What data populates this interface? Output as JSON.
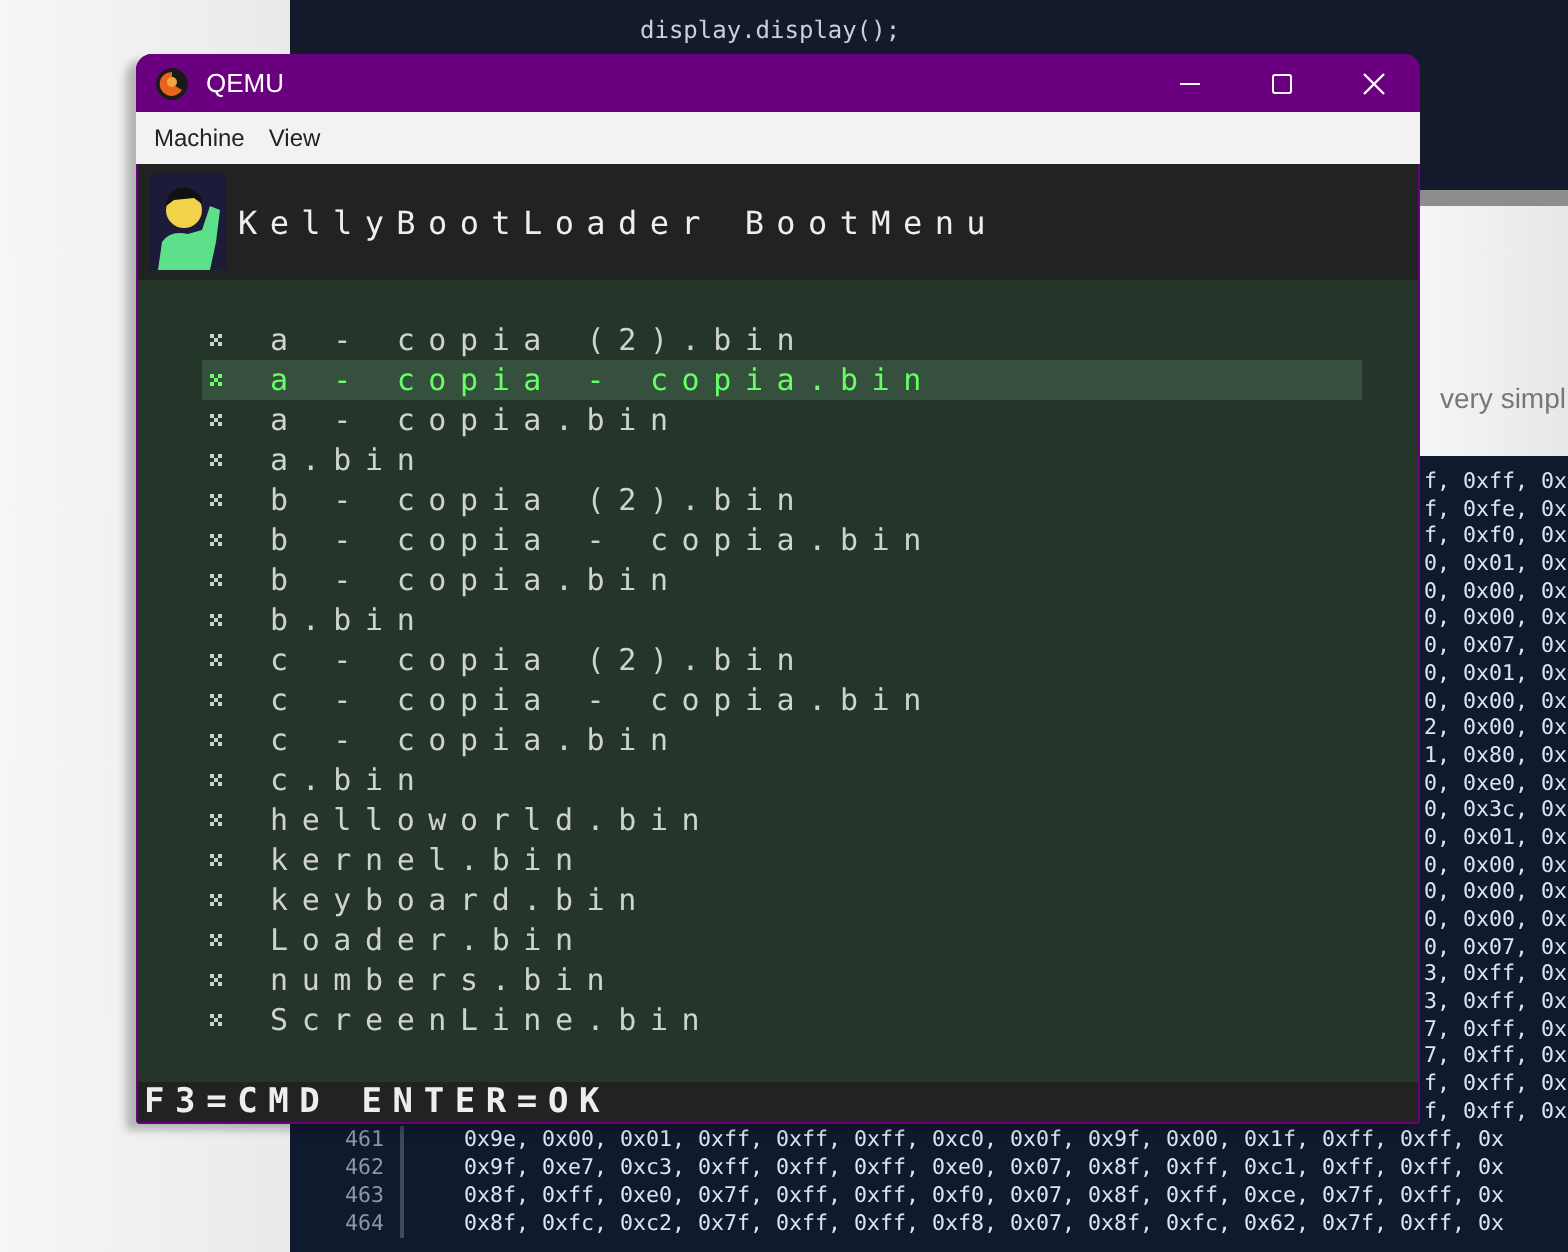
{
  "editor_top": {
    "code_line": "display.display();"
  },
  "article": {
    "text_fragment": "very simpl"
  },
  "code_fragments": [
    "f, 0xff, 0x",
    "f, 0xfe, 0x",
    "f, 0xf0, 0x",
    "0, 0x01, 0x",
    "0, 0x00, 0x",
    "0, 0x00, 0x",
    "0, 0x07, 0x",
    "0, 0x01, 0x",
    "0, 0x00, 0x",
    "2, 0x00, 0x",
    "1, 0x80, 0x",
    "0, 0xe0, 0x",
    "0, 0x3c, 0x",
    "0, 0x01, 0x",
    "0, 0x00, 0x",
    "0, 0x00, 0x",
    "0, 0x00, 0x",
    "0, 0x07, 0x",
    "3, 0xff, 0x",
    "3, 0xff, 0x",
    "7, 0xff, 0x",
    "7, 0xff, 0x",
    "f, 0xff, 0x",
    "f, 0xff, 0x"
  ],
  "code_lines": [
    {
      "number": "461",
      "text": "0x9e, 0x00, 0x01, 0xff, 0xff, 0xff, 0xc0, 0x0f, 0x9f, 0x00, 0x1f, 0xff, 0xff, 0x"
    },
    {
      "number": "462",
      "text": "0x9f, 0xe7, 0xc3, 0xff, 0xff, 0xff, 0xe0, 0x07, 0x8f, 0xff, 0xc1, 0xff, 0xff, 0x"
    },
    {
      "number": "463",
      "text": "0x8f, 0xff, 0xe0, 0x7f, 0xff, 0xff, 0xf0, 0x07, 0x8f, 0xff, 0xce, 0x7f, 0xff, 0x"
    },
    {
      "number": "464",
      "text": "0x8f, 0xfc, 0xc2, 0x7f, 0xff, 0xff, 0xf8, 0x07, 0x8f, 0xfc, 0x62, 0x7f, 0xff, 0x"
    }
  ],
  "window": {
    "title": "QEMU"
  },
  "menu": [
    "Machine",
    "View"
  ],
  "boot_menu": {
    "title": "KellyBootLoader BootMenu",
    "items": [
      {
        "label": "a - copia (2).bin",
        "selected": false
      },
      {
        "label": "a - copia - copia.bin",
        "selected": true
      },
      {
        "label": "a - copia.bin",
        "selected": false
      },
      {
        "label": "a.bin",
        "selected": false
      },
      {
        "label": "b - copia (2).bin",
        "selected": false
      },
      {
        "label": "b - copia - copia.bin",
        "selected": false
      },
      {
        "label": "b - copia.bin",
        "selected": false
      },
      {
        "label": "b.bin",
        "selected": false
      },
      {
        "label": "c - copia (2).bin",
        "selected": false
      },
      {
        "label": "c - copia - copia.bin",
        "selected": false
      },
      {
        "label": "c - copia.bin",
        "selected": false
      },
      {
        "label": "c.bin",
        "selected": false
      },
      {
        "label": "helloworld.bin",
        "selected": false
      },
      {
        "label": "kernel.bin",
        "selected": false
      },
      {
        "label": "keyboard.bin",
        "selected": false
      },
      {
        "label": "Loader.bin",
        "selected": false
      },
      {
        "label": "numbers.bin",
        "selected": false
      },
      {
        "label": "ScreenLine.bin",
        "selected": false
      }
    ],
    "footer": "F3=CMD ENTER=OK"
  }
}
